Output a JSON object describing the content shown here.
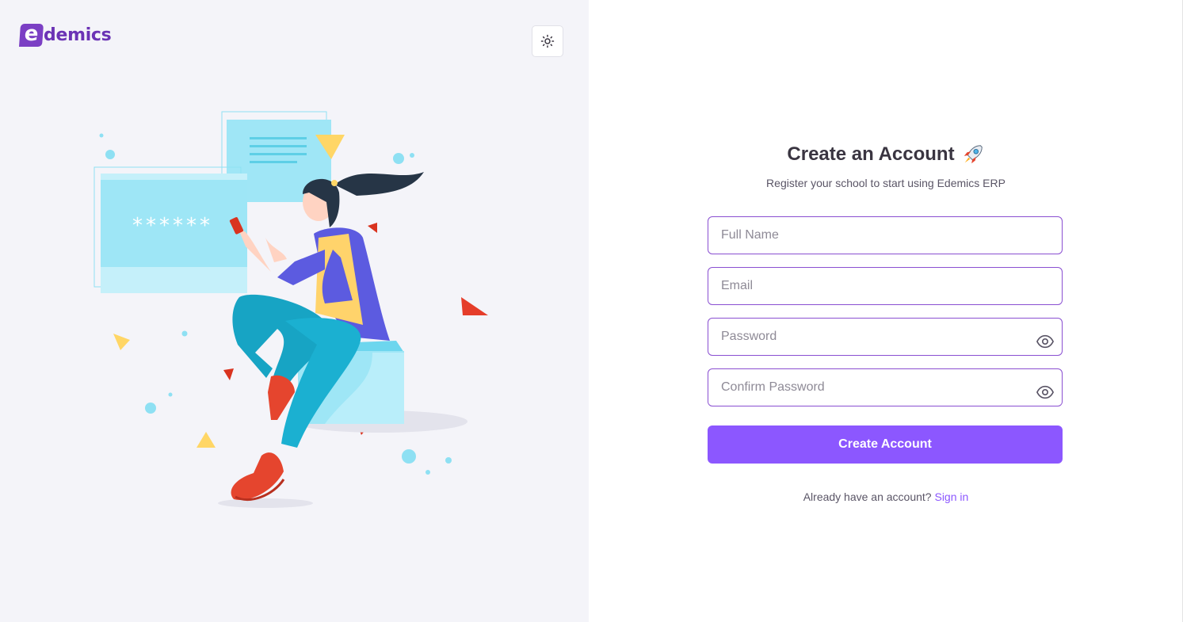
{
  "brand": {
    "logo_letter": "e",
    "logo_text": "demics"
  },
  "theme_toggle": {
    "icon": "sun-icon"
  },
  "illustration": {
    "password_mask": "******"
  },
  "form": {
    "title": "Create an Account",
    "title_emoji": "rocket-icon",
    "subtitle": "Register your school to start using Edemics ERP",
    "full_name_placeholder": "Full Name",
    "email_placeholder": "Email",
    "password_placeholder": "Password",
    "confirm_password_placeholder": "Confirm Password",
    "submit_label": "Create Account"
  },
  "footer": {
    "prompt": "Already have an account?",
    "signin_label": "Sign in"
  },
  "colors": {
    "primary": "#8c57ff",
    "logo": "#6b33b5",
    "field_border": "#8a4fd1",
    "left_bg": "#f4f4f9"
  }
}
